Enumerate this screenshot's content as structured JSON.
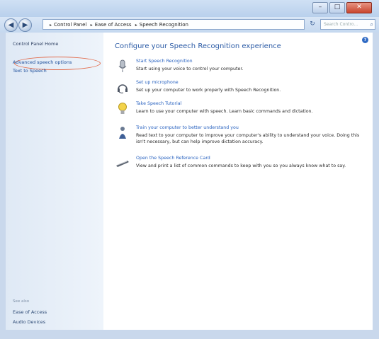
{
  "window": {
    "caption": {
      "minimize": "–",
      "maximize": "□",
      "close": "✕"
    }
  },
  "addressbar": {
    "back_glyph": "◀",
    "forward_glyph": "▶",
    "breadcrumb": [
      "Control Panel",
      "Ease of Access",
      "Speech Recognition"
    ],
    "refresh_glyph": "↻",
    "search_placeholder": "Search Contro...",
    "search_icon": "magnifier-icon"
  },
  "leftpane": {
    "home": "Control Panel Home",
    "links": [
      "Advanced speech options",
      "Text to Speech"
    ],
    "see_also_label": "See also",
    "see_also": [
      "Ease of Access",
      "Audio Devices"
    ]
  },
  "main": {
    "help": "?",
    "title": "Configure your Speech Recognition experience",
    "tasks": [
      {
        "icon": "microphone-icon",
        "link": "Start Speech Recognition",
        "desc": "Start using your voice to control your computer."
      },
      {
        "icon": "headset-icon",
        "link": "Set up microphone",
        "desc": "Set up your computer to work properly with Speech Recognition."
      },
      {
        "icon": "lightbulb-icon",
        "link": "Take Speech Tutorial",
        "desc": "Learn to use your computer with speech.  Learn basic commands and dictation."
      },
      {
        "icon": "person-speech-icon",
        "link": "Train your computer to better understand you",
        "desc": "Read text to your computer to improve your computer's ability to understand your voice. Doing this isn't necessary, but can help improve dictation accuracy."
      },
      {
        "icon": "card-icon",
        "link": "Open the Speech Reference Card",
        "desc": "View and print a list of common commands to keep with you so you always know what to say."
      }
    ]
  }
}
